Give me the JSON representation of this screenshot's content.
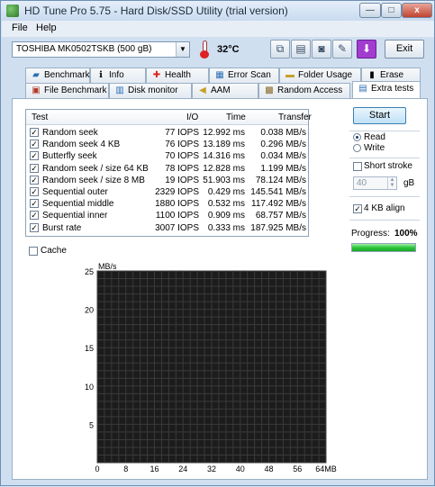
{
  "window": {
    "title": "HD Tune Pro 5.75 - Hard Disk/SSD Utility (trial version)",
    "controls": {
      "minimize": "—",
      "maximize": "□",
      "close": "x"
    }
  },
  "menu": {
    "file": "File",
    "help": "Help"
  },
  "toolbar": {
    "drive": "TOSHIBA MK0502TSKB (500 gB)",
    "temperature": "32°C",
    "exit_label": "Exit",
    "icons": [
      "copy-icon",
      "paste-icon",
      "camera-icon",
      "disk-info-icon",
      "download-icon"
    ]
  },
  "tabs_top": [
    {
      "label": "Benchmark",
      "icon": "benchmark-icon"
    },
    {
      "label": "Info",
      "icon": "info-icon"
    },
    {
      "label": "Health",
      "icon": "health-icon"
    },
    {
      "label": "Error Scan",
      "icon": "error-scan-icon"
    },
    {
      "label": "Folder Usage",
      "icon": "folder-icon"
    },
    {
      "label": "Erase",
      "icon": "erase-icon"
    }
  ],
  "tabs_bottom": [
    {
      "label": "File Benchmark",
      "icon": "file-benchmark-icon"
    },
    {
      "label": "Disk monitor",
      "icon": "disk-monitor-icon"
    },
    {
      "label": "AAM",
      "icon": "speaker-icon"
    },
    {
      "label": "Random Access",
      "icon": "random-access-icon"
    },
    {
      "label": "Extra tests",
      "icon": "extra-tests-icon"
    }
  ],
  "table": {
    "headers": {
      "test": "Test",
      "io": "I/O",
      "time": "Time",
      "transfer": "Transfer"
    },
    "rows": [
      {
        "test": "Random seek",
        "io": "77 IOPS",
        "time": "12.992 ms",
        "transfer": "0.038 MB/s",
        "checked": true
      },
      {
        "test": "Random seek 4 KB",
        "io": "76 IOPS",
        "time": "13.189 ms",
        "transfer": "0.296 MB/s",
        "checked": true
      },
      {
        "test": "Butterfly seek",
        "io": "70 IOPS",
        "time": "14.316 ms",
        "transfer": "0.034 MB/s",
        "checked": true
      },
      {
        "test": "Random seek / size 64 KB",
        "io": "78 IOPS",
        "time": "12.828 ms",
        "transfer": "1.199 MB/s",
        "checked": true
      },
      {
        "test": "Random seek / size 8 MB",
        "io": "19 IOPS",
        "time": "51.903 ms",
        "transfer": "78.124 MB/s",
        "checked": true
      },
      {
        "test": "Sequential outer",
        "io": "2329 IOPS",
        "time": "0.429 ms",
        "transfer": "145.541 MB/s",
        "checked": true
      },
      {
        "test": "Sequential middle",
        "io": "1880 IOPS",
        "time": "0.532 ms",
        "transfer": "117.492 MB/s",
        "checked": true
      },
      {
        "test": "Sequential inner",
        "io": "1100 IOPS",
        "time": "0.909 ms",
        "transfer": "68.757 MB/s",
        "checked": true
      },
      {
        "test": "Burst rate",
        "io": "3007 IOPS",
        "time": "0.333 ms",
        "transfer": "187.925 MB/s",
        "checked": true
      }
    ]
  },
  "controls": {
    "start_label": "Start",
    "read_label": "Read",
    "write_label": "Write",
    "mode": "read",
    "short_stroke_label": "Short stroke",
    "short_stroke_checked": false,
    "short_stroke_value": "40",
    "short_stroke_unit": "gB",
    "align_label": "4 KB align",
    "align_checked": true,
    "progress_label": "Progress:",
    "progress_text": "100%",
    "progress_value": 1.0,
    "cache_label": "Cache",
    "cache_checked": false
  },
  "chart_data": {
    "type": "line",
    "title": "",
    "ylabel": "MB/s",
    "xlabel": "",
    "ylim": [
      0,
      25
    ],
    "xlim": [
      0,
      64
    ],
    "yticks": [
      "25",
      "20",
      "15",
      "10",
      "5"
    ],
    "xticks": [
      "0",
      "8",
      "16",
      "24",
      "32",
      "40",
      "48",
      "56",
      "64MB"
    ],
    "grid": true,
    "series": []
  }
}
